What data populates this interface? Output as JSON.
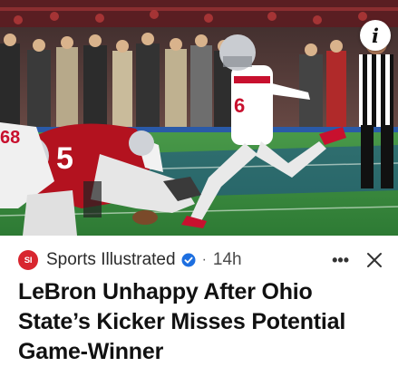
{
  "article_card": {
    "info_button_glyph": "i",
    "source": {
      "logo_text": "SI",
      "name": "Sports Illustrated",
      "verified_icon": "verified-badge-icon"
    },
    "separator": "·",
    "time_ago": "14h",
    "more_glyph": "•••",
    "close_icon": "close-icon",
    "headline": "LeBron Unhappy After Ohio State’s Kicker Misses Potential Game-Winner",
    "colors": {
      "brand_red": "#d8262f",
      "verified_blue": "#1d6fe0",
      "headline": "#111111"
    }
  }
}
